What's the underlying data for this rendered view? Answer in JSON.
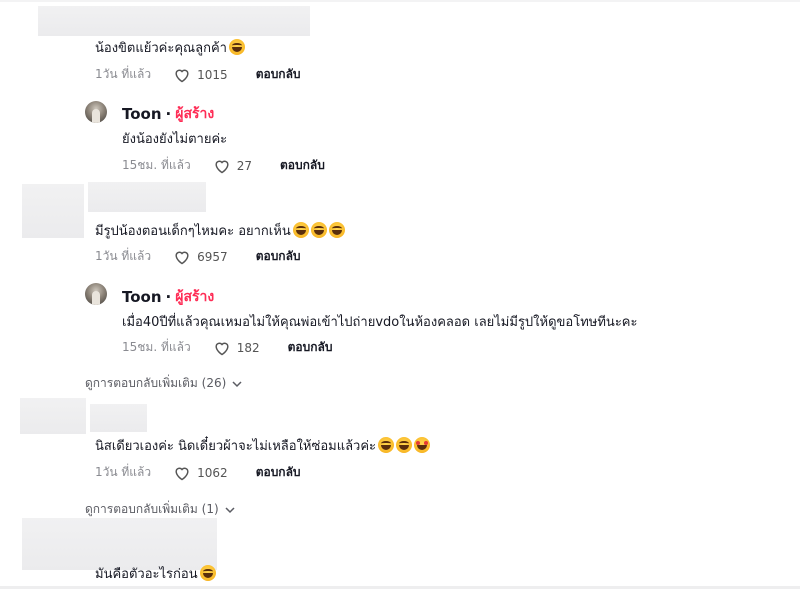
{
  "comments": [
    {
      "text": "น้องขิตแย้วค่ะคุณลูกค้า",
      "time": "1วัน ที่แล้ว",
      "likes": "1015",
      "reply": "ตอบกลับ"
    },
    {
      "author": "Toon",
      "dot": "·",
      "creator_badge": "ผู้สร้าง",
      "text": "ยังน้องยังไม่ตายค่ะ",
      "time": "15ชม. ที่แล้ว",
      "likes": "27",
      "reply": "ตอบกลับ"
    },
    {
      "text": "มีรูปน้องตอนเด็กๆไหมคะ อยากเห็น",
      "time": "1วัน ที่แล้ว",
      "likes": "6957",
      "reply": "ตอบกลับ"
    },
    {
      "author": "Toon",
      "dot": "·",
      "creator_badge": "ผู้สร้าง",
      "text": "เมื่อ40ปีที่แล้วคุณเหมอไม่ให้คุณพ่อเข้าไปถ่ายvdoในห้องคลอด เลยไม่มีรูปให้ดูขอโทษทีนะคะ",
      "time": "15ชม. ที่แล้ว",
      "likes": "182",
      "reply": "ตอบกลับ"
    },
    {
      "text": "นิสเดียวเองค่ะ นิดเดี๋ยวผ้าจะไม่เหลือให้ซ่อมแล้วค่ะ",
      "time": "1วัน ที่แล้ว",
      "likes": "1062",
      "reply": "ตอบกลับ"
    },
    {
      "text": "มันคือตัวอะไรก่อน"
    }
  ],
  "view_more": [
    {
      "label": "ดูการตอบกลับเพิ่มเติม (26)"
    },
    {
      "label": "ดูการตอบกลับเพิ่มเติม (1)"
    }
  ],
  "icons": {
    "like": "heart-outline-icon",
    "expand": "chevron-down-icon"
  },
  "colors": {
    "creator": "#fe2c55",
    "meta": "#8a8b91",
    "text": "#161823"
  }
}
